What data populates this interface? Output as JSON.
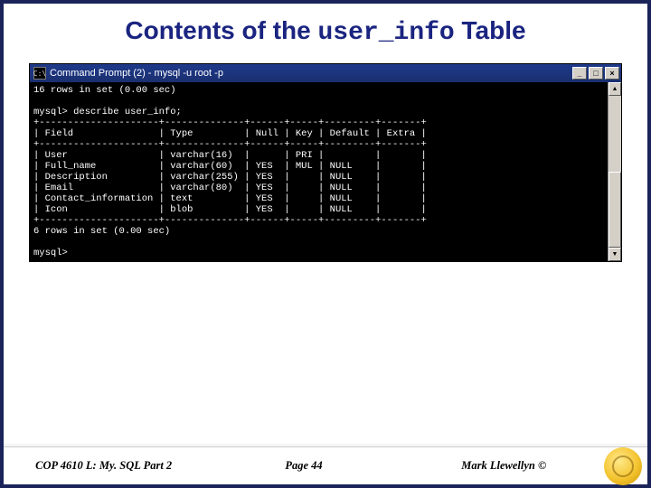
{
  "title": {
    "prefix": "Contents of the ",
    "mono": "user_info",
    "suffix": " Table"
  },
  "terminal": {
    "window_title": "Command Prompt (2) - mysql -u root -p",
    "icon_glyph": "C:\\",
    "buttons": {
      "minimize": "_",
      "maximize": "□",
      "close": "×"
    },
    "scroll": {
      "up": "▲",
      "down": "▼"
    },
    "intro_rows": "16 rows in set (0.00 sec)",
    "prompt_cmd": "mysql> describe user_info;",
    "columns": [
      "Field",
      "Type",
      "Null",
      "Key",
      "Default",
      "Extra"
    ],
    "rows": [
      {
        "field": "User",
        "type": "varchar(16)",
        "null": "",
        "key": "PRI",
        "default": "",
        "extra": ""
      },
      {
        "field": "Full_name",
        "type": "varchar(60)",
        "null": "YES",
        "key": "MUL",
        "default": "NULL",
        "extra": ""
      },
      {
        "field": "Description",
        "type": "varchar(255)",
        "null": "YES",
        "key": "",
        "default": "NULL",
        "extra": ""
      },
      {
        "field": "Email",
        "type": "varchar(80)",
        "null": "YES",
        "key": "",
        "default": "NULL",
        "extra": ""
      },
      {
        "field": "Contact_information",
        "type": "text",
        "null": "YES",
        "key": "",
        "default": "NULL",
        "extra": ""
      },
      {
        "field": "Icon",
        "type": "blob",
        "null": "YES",
        "key": "",
        "default": "NULL",
        "extra": ""
      }
    ],
    "outro_rows": "6 rows in set (0.00 sec)",
    "final_prompt": "mysql>",
    "widths": {
      "field": 21,
      "type": 14,
      "null": 6,
      "key": 5,
      "default": 9,
      "extra": 7
    }
  },
  "footer": {
    "left": "COP 4610 L: My. SQL Part 2",
    "center": "Page 44",
    "right": "Mark Llewellyn ©"
  }
}
